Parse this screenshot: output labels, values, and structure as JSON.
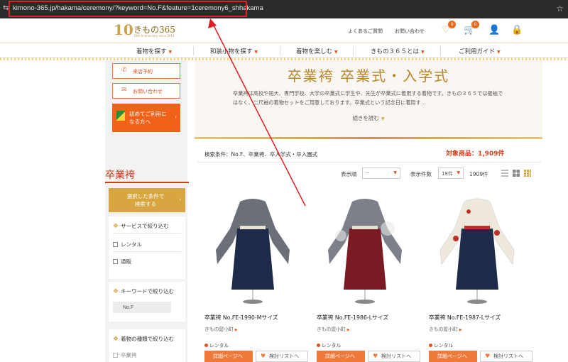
{
  "browser": {
    "url": "kimono-365.jp/hakama/ceremony/?keyword=No.F&feature=1ceremony6_shhakama",
    "tune_icon": "tune-icon",
    "star_icon": "bookmark-star-icon"
  },
  "header": {
    "logo_brand": "きもの365",
    "logo_sub": "10th Anniversary since 2014",
    "faq": "よくあるご質問",
    "contact": "お問い合わせ",
    "favorites_count": "0",
    "cart_count": "0"
  },
  "nav": {
    "items": [
      "着物を探す",
      "和装小物を探す",
      "着物を楽しむ",
      "きもの３６５とは",
      "ご利用ガイド"
    ]
  },
  "sidebar": {
    "reserve_label": "来店予約",
    "inquiry_label": "お問い合わせ",
    "first_time_label": "初めてご利用に\nなる方へ",
    "category_title": "卒業袴",
    "search_button": "選択した条件で\n検索する",
    "service_filter_title": "サービスで絞り込む",
    "service_options": [
      "レンタル",
      "通販"
    ],
    "keyword_filter_title": "キーワードで絞り込む",
    "keyword_value": "No.F",
    "type_filter_title": "着物の種類で絞り込む",
    "type_options": [
      "卒業袴"
    ]
  },
  "hero": {
    "title": "卒業袴 卒業式・入学式",
    "description": "卒業袴は高校や短大、専門学校、大学の卒業式に学生や、先生が卒業式に着用する着物です。きもの３６５では振袖ではなく、二尺袖の着物セットをご用意しております。卒業式という記念日に着用す…",
    "read_more": "続きを読む"
  },
  "results": {
    "criteria": "検索条件：No.F、卒業袴、卒入学式・卒入園式",
    "count_label": "対象商品：1,909件",
    "sort_label": "表示順",
    "sort_value": "--",
    "per_page_label": "表示件数",
    "per_page_value": "18件",
    "total": "1909件"
  },
  "products": [
    {
      "name": "卒業袴 No.FE-1990-Mサイズ",
      "shop": "きもの屋小町",
      "service": "レンタル",
      "detail": "詳細ページへ",
      "wishlist": "検討リストへ",
      "hakama_color": "#1e2a4a",
      "kimono_color": "#6a6f78"
    },
    {
      "name": "卒業袴 No.FE-1986-Lサイズ",
      "shop": "きもの屋小町",
      "service": "レンタル",
      "detail": "詳細ページへ",
      "wishlist": "検討リストへ",
      "hakama_color": "#7a1a22",
      "kimono_color": "#7d8088"
    },
    {
      "name": "卒業袴 No.FE-1987-Lサイズ",
      "shop": "きもの屋小町",
      "service": "レンタル",
      "detail": "詳細ページへ",
      "wishlist": "検討リストへ",
      "hakama_color": "#1e2a4a",
      "kimono_color": "#efe9dd"
    }
  ],
  "colors": {
    "accent_orange": "#f0621a",
    "gold": "#d8a640",
    "annotation_red": "#e02020"
  }
}
